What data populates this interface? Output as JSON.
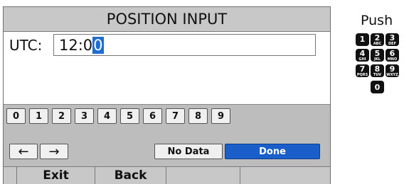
{
  "screen": {
    "title": "POSITION INPUT",
    "utc_label": "UTC:",
    "utc_value_prefix": "12:0",
    "utc_value_cursor": "0"
  },
  "keypad": {
    "digits": [
      "0",
      "1",
      "2",
      "3",
      "4",
      "5",
      "6",
      "7",
      "8",
      "9"
    ],
    "left_arrow": "←",
    "right_arrow": "→",
    "no_data_label": "No Data",
    "done_label": "Done"
  },
  "softkeys": [
    "Exit",
    "Back",
    "",
    ""
  ],
  "push_panel": {
    "label": "Push",
    "keys": [
      {
        "digit": "1",
        "letters": ""
      },
      {
        "digit": "2",
        "letters": "ABC"
      },
      {
        "digit": "3",
        "letters": "DEF"
      },
      {
        "digit": "4",
        "letters": "GHI"
      },
      {
        "digit": "5",
        "letters": "JKL"
      },
      {
        "digit": "6",
        "letters": "MNO"
      },
      {
        "digit": "7",
        "letters": "PQRS"
      },
      {
        "digit": "8",
        "letters": "TUV"
      },
      {
        "digit": "9",
        "letters": "WXYZ"
      },
      {
        "digit": "0",
        "letters": ""
      }
    ]
  },
  "colors": {
    "title_bar": "#c8c8c8",
    "key_panel": "#bdbdbd",
    "done_button": "#1a5fc9",
    "cursor": "#1c6fd1"
  }
}
